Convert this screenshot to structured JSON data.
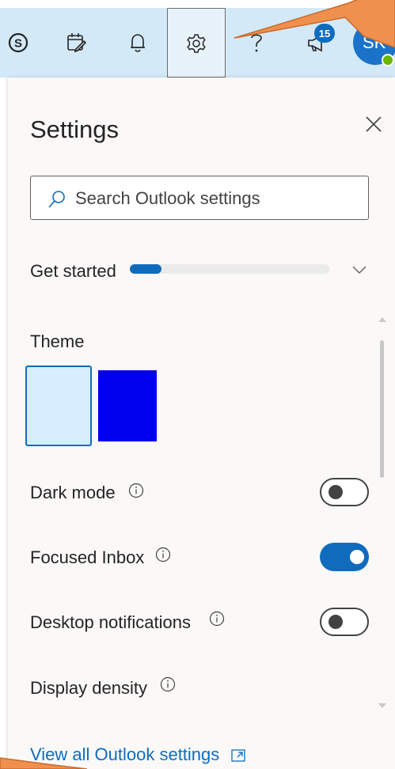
{
  "topbar": {
    "icons": [
      "skype-icon",
      "calendar-check-icon",
      "bell-icon",
      "gear-icon",
      "help-icon",
      "megaphone-icon"
    ],
    "notification_badge": "15",
    "avatar_initials": "SK",
    "avatar_status": "available"
  },
  "settings": {
    "title": "Settings",
    "search": {
      "placeholder": "Search Outlook settings"
    },
    "get_started": {
      "label": "Get started",
      "progress": 0.16
    },
    "theme": {
      "label": "Theme",
      "swatches": [
        {
          "name": "light",
          "color": "#d7edfd",
          "selected": true
        },
        {
          "name": "blue",
          "color": "#0000ee",
          "selected": false
        }
      ]
    },
    "toggles": [
      {
        "label": "Dark mode",
        "on": false
      },
      {
        "label": "Focused Inbox",
        "on": true
      },
      {
        "label": "Desktop notifications",
        "on": false
      }
    ],
    "display_density": {
      "label": "Display density"
    },
    "view_all_link": "View all Outlook settings"
  },
  "colors": {
    "topbar_bg": "#d3e9f8",
    "panel_bg": "#faf9f8",
    "accent": "#0f6cbd",
    "annotation_arrow": "#f0904e"
  }
}
